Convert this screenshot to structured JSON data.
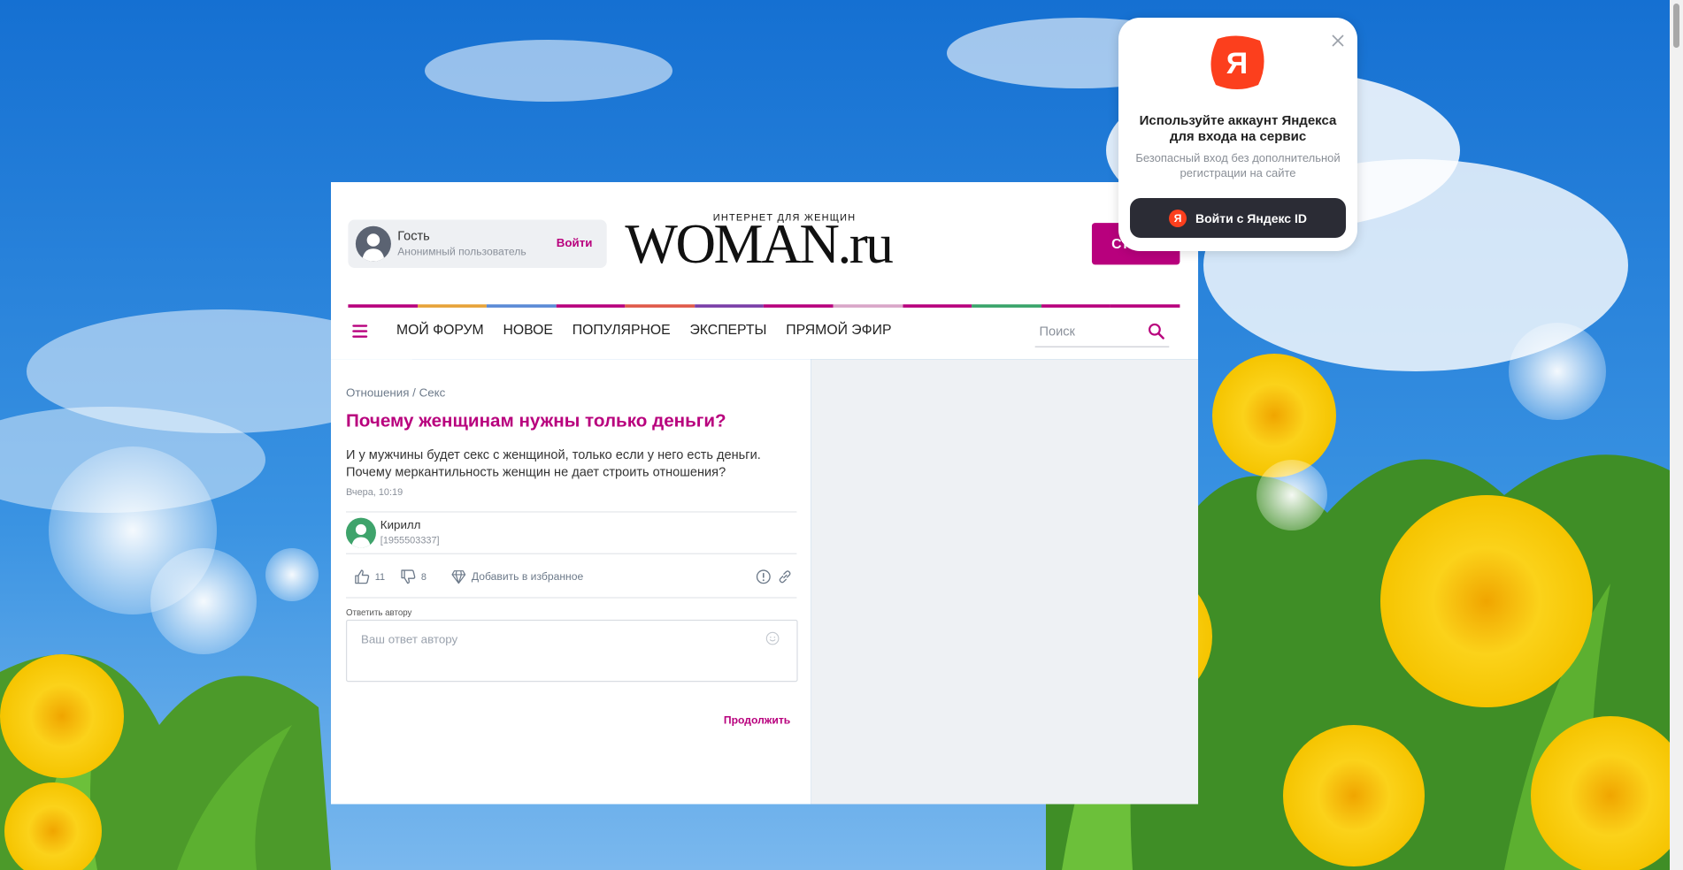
{
  "header": {
    "guest_name": "Гость",
    "guest_sub": "Анонимный пользователь",
    "login_label": "Войти",
    "logo_small": "ИНТЕРНЕТ ДЛЯ ЖЕНЩИН",
    "logo_big": "WOMAN.ru",
    "articles_label": "Статьи"
  },
  "nav": {
    "items": [
      "МОЙ ФОРУМ",
      "НОВОЕ",
      "ПОПУЛЯРНОЕ",
      "ЭКСПЕРТЫ",
      "ПРЯМОЙ ЭФИР"
    ],
    "search_placeholder": "Поиск"
  },
  "stripe_colors": [
    "#b8007d",
    "#e7a33a",
    "#5b8bd6",
    "#b8007d",
    "#e05a4a",
    "#7a3fa8",
    "#b8007d",
    "#d9a6c8",
    "#b8007d",
    "#3aa46a",
    "#b8007d",
    "#b8007d"
  ],
  "post": {
    "breadcrumb": [
      "Отношения",
      "Секс"
    ],
    "breadcrumb_sep": "/",
    "title": "Почему женщинам нужны только деньги?",
    "desc_line1": "И у мужчины будет секс с женщиной, только если у него есть деньги.",
    "desc_line2": "Почему меркантильность женщин не дает строить отношения?",
    "date": "Вчера, 10:19",
    "author_name": "Кирилл",
    "author_id": "[1955503337]",
    "likes": "11",
    "dislikes": "8",
    "favorite_label": "Добавить в избранное",
    "reply_label": "Ответить автору",
    "reply_placeholder": "Ваш ответ автору",
    "continue_label": "Продолжить"
  },
  "yandex": {
    "logo_letter": "Я",
    "heading_line1": "Используйте аккаунт Яндекса",
    "heading_line2": "для входа на сервис",
    "text_line1": "Безопасный вход без дополнительной",
    "text_line2": "регистрации на сайте",
    "button_label": "Войти с Яндекс ID",
    "button_logo": "Я"
  },
  "colors": {
    "accent": "#b8007d",
    "yandex_red": "#fc3f1d",
    "yandex_button": "#2b2c35"
  }
}
